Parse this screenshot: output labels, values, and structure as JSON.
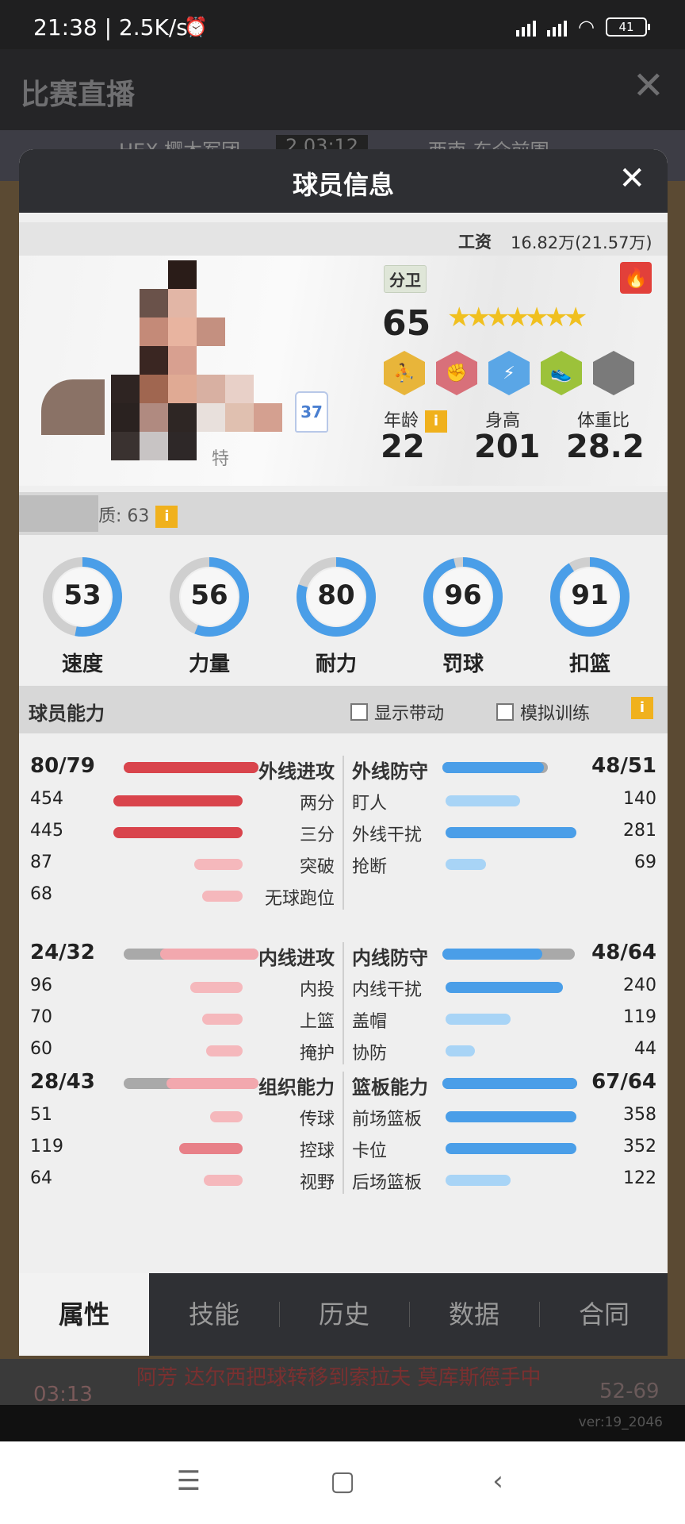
{
  "status_bar": {
    "time": "21:38 | 2.5K/s",
    "battery": "41",
    "alarm_icon": "alarm-icon",
    "wifi_icon": "wifi-icon"
  },
  "background": {
    "page_title": "比赛直播",
    "team_home": "HEX-樱木军团",
    "score_box": "2   03:12",
    "team_away": "西南-东介前围",
    "event_time": "03:13",
    "event_text": "阿芳 达尔西把球转移到索拉夫 莫库斯德手中",
    "event_score": "52-69",
    "version": "ver:19_2046"
  },
  "dialog": {
    "title": "球员信息",
    "salary_label": "工资",
    "salary_value": "16.82万(21.57万)",
    "position": "分卫",
    "overall": "65",
    "stars": "★★★★★★★",
    "jersey_number": "37",
    "name_fragment": "特",
    "potential_text": "质: 63",
    "age_label": "年龄",
    "age_value": "22",
    "height_label": "身高",
    "height_value": "201",
    "bmi_label": "体重比",
    "bmi_value": "28.2",
    "badges": [
      "badge-scorer-icon",
      "badge-fist-icon",
      "badge-shield-icon",
      "badge-shoe-icon",
      "badge-locked-icon"
    ],
    "gauges": [
      {
        "value": "53",
        "label": "速度",
        "fraction": 0.53
      },
      {
        "value": "56",
        "label": "力量",
        "fraction": 0.56
      },
      {
        "value": "80",
        "label": "耐力",
        "fraction": 0.8
      },
      {
        "value": "96",
        "label": "罚球",
        "fraction": 0.96
      },
      {
        "value": "91",
        "label": "扣篮",
        "fraction": 0.91
      }
    ],
    "ability": {
      "title": "球员能力",
      "checkbox_dribble": "显示带动",
      "checkbox_train": "模拟训练"
    },
    "groups": [
      {
        "left": {
          "total": "80/79",
          "name": "外线进攻",
          "fill": 1.0,
          "track": 1.0,
          "items": [
            {
              "value": "454",
              "name": "两分",
              "fill": 0.96
            },
            {
              "value": "445",
              "name": "三分",
              "fill": 0.96
            },
            {
              "value": "87",
              "name": "突破",
              "fill": 0.36
            },
            {
              "value": "68",
              "name": "无球跑位",
              "fill": 0.3
            }
          ]
        },
        "right": {
          "total": "48/51",
          "name": "外线防守",
          "fill": 0.75,
          "track": 0.78,
          "items": [
            {
              "value": "140",
              "name": "盯人",
              "fill": 0.55
            },
            {
              "value": "281",
              "name": "外线干扰",
              "fill": 0.97
            },
            {
              "value": "69",
              "name": "抢断",
              "fill": 0.3
            }
          ]
        }
      },
      {
        "left": {
          "total": "24/32",
          "name": "内线进攻",
          "fill": 0.73,
          "track": 1.0,
          "items": [
            {
              "value": "96",
              "name": "内投",
              "fill": 0.39
            },
            {
              "value": "70",
              "name": "上篮",
              "fill": 0.3
            },
            {
              "value": "60",
              "name": "掩护",
              "fill": 0.27
            }
          ]
        },
        "right": {
          "total": "48/64",
          "name": "内线防守",
          "fill": 0.74,
          "track": 0.98,
          "items": [
            {
              "value": "240",
              "name": "内线干扰",
              "fill": 0.87
            },
            {
              "value": "119",
              "name": "盖帽",
              "fill": 0.48
            },
            {
              "value": "44",
              "name": "协防",
              "fill": 0.22
            }
          ]
        }
      },
      {
        "left": {
          "total": "28/43",
          "name": "组织能力",
          "fill": 0.68,
          "track": 1.0,
          "items": [
            {
              "value": "51",
              "name": "传球",
              "fill": 0.24
            },
            {
              "value": "119",
              "name": "控球",
              "fill": 0.47
            },
            {
              "value": "64",
              "name": "视野",
              "fill": 0.29
            }
          ]
        },
        "right": {
          "total": "67/64",
          "name": "篮板能力",
          "fill": 1.0,
          "track": 1.0,
          "items": [
            {
              "value": "358",
              "name": "前场篮板",
              "fill": 0.97
            },
            {
              "value": "352",
              "name": "卡位",
              "fill": 0.97
            },
            {
              "value": "122",
              "name": "后场篮板",
              "fill": 0.48
            }
          ]
        }
      }
    ],
    "tabs": [
      "属性",
      "技能",
      "历史",
      "数据",
      "合同"
    ],
    "active_tab": "属性"
  }
}
